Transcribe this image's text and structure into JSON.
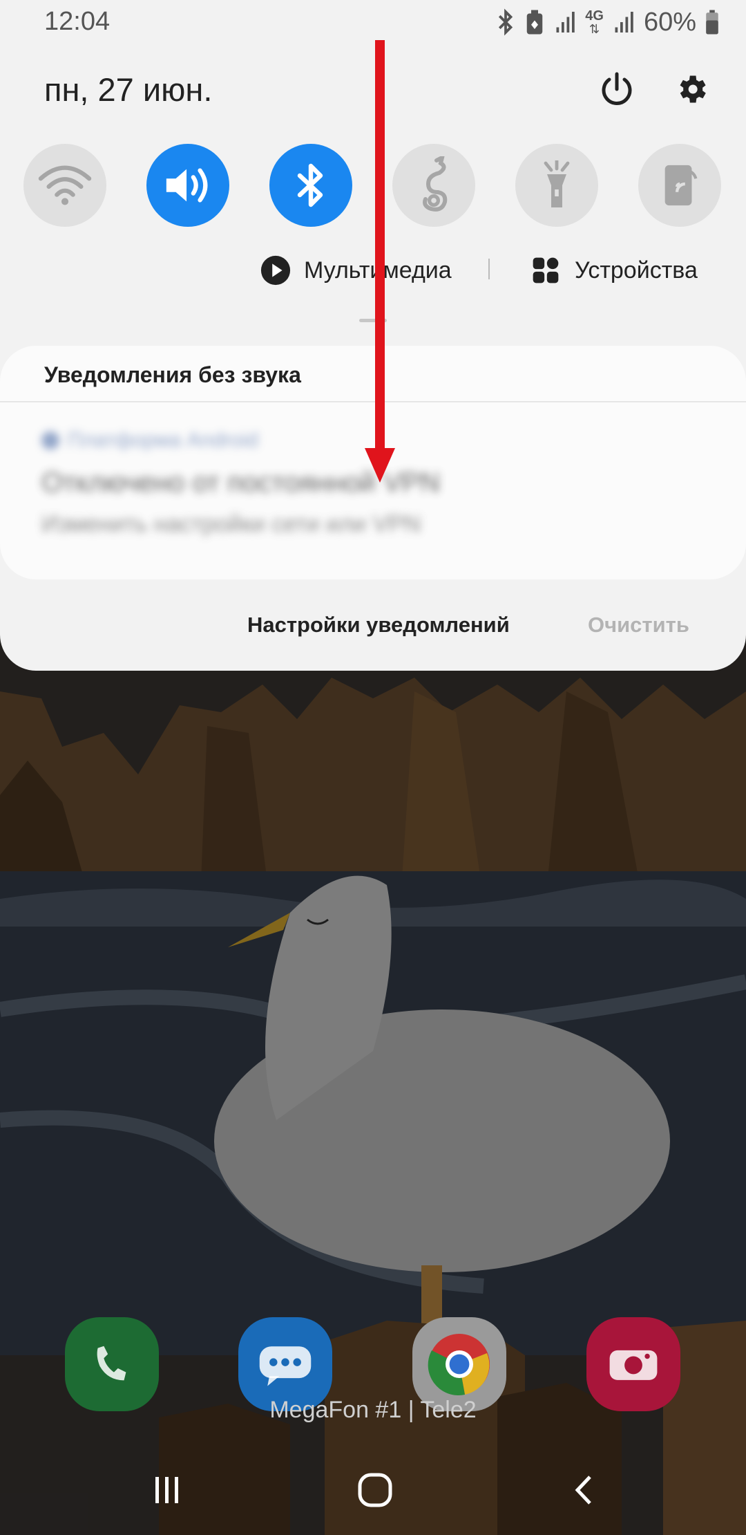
{
  "status_bar": {
    "time": "12:04",
    "network_label": "4G",
    "battery": "60%",
    "icons": [
      "bluetooth-icon",
      "battery-saver-icon",
      "signal-icon",
      "4g-data-icon",
      "signal-icon",
      "battery-icon"
    ]
  },
  "header": {
    "date": "пн, 27 июн.",
    "power_icon": "power-icon",
    "settings_icon": "gear-icon"
  },
  "quick_tiles": [
    {
      "name": "wifi",
      "icon": "wifi-icon",
      "active": false
    },
    {
      "name": "sound",
      "icon": "volume-icon",
      "active": true
    },
    {
      "name": "bluetooth",
      "icon": "bluetooth-icon",
      "active": true
    },
    {
      "name": "dragon",
      "icon": "dragon-icon",
      "active": false
    },
    {
      "name": "flashlight",
      "icon": "flashlight-icon",
      "active": false
    },
    {
      "name": "phone-cast",
      "icon": "phone-cast-icon",
      "active": false
    }
  ],
  "media_row": {
    "media_label": "Мультимедиа",
    "devices_label": "Устройства"
  },
  "notifications": {
    "section_title": "Уведомления без звука",
    "blurred_item": {
      "app": "Платформа Android",
      "title": "Отключено от постоянной VPN",
      "text": "Изменить настройки сети или VPN"
    },
    "settings_label": "Настройки уведомлений",
    "clear_label": "Очистить"
  },
  "colors": {
    "accent": "#1a87f0",
    "annotation_arrow": "#e0141c",
    "shade_background": "#f2f2f2"
  },
  "home": {
    "dock_apps": [
      "phone-icon",
      "messages-icon",
      "chrome-icon",
      "camera-icon"
    ],
    "carrier_text": "MegaFon #1 | Tele2"
  },
  "nav_bar": [
    "recents-icon",
    "home-icon",
    "back-icon"
  ]
}
